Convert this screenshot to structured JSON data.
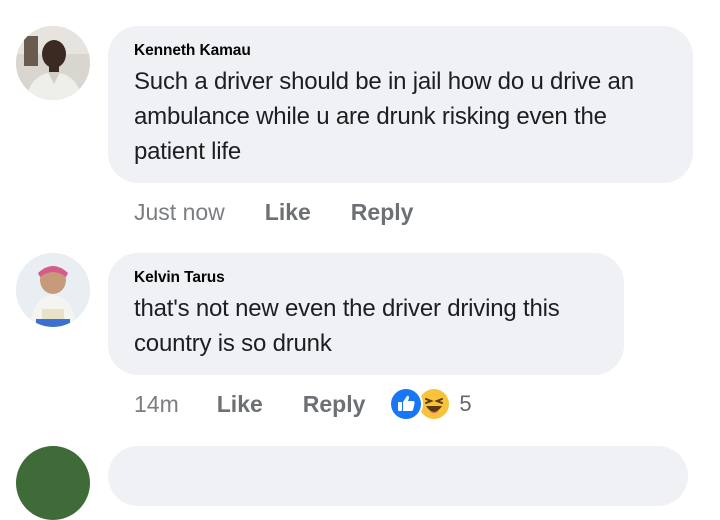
{
  "comments": [
    {
      "author": "Kenneth Kamau",
      "text": "Such a driver should be in jail how do u drive an ambulance while u are drunk risking even the patient life",
      "time": "Just now",
      "like_label": "Like",
      "reply_label": "Reply"
    },
    {
      "author": "Kelvin Tarus",
      "text": "that's not new even the driver driving this country is so drunk",
      "time": "14m",
      "like_label": "Like",
      "reply_label": "Reply",
      "reaction_count": "5",
      "reactions": [
        "like-icon",
        "haha-icon"
      ]
    }
  ],
  "colors": {
    "bubble": "#eff1f4",
    "like_blue": "#1877f2",
    "haha_yellow": "#f7c33b"
  }
}
